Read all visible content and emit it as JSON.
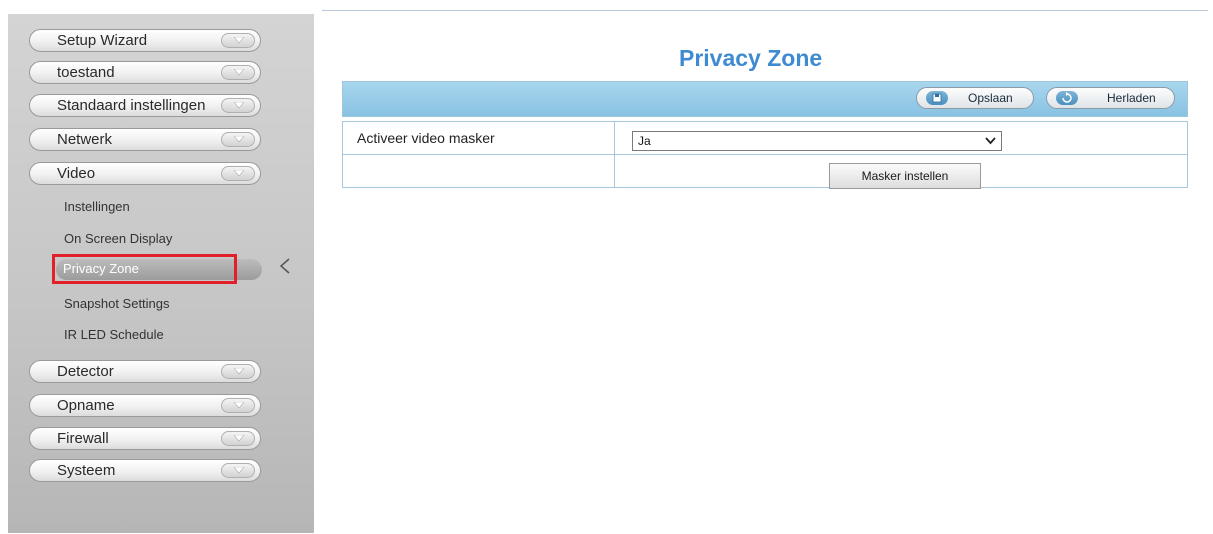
{
  "sidebar": {
    "top_items": [
      {
        "label": "Setup Wizard"
      },
      {
        "label": "toestand"
      },
      {
        "label": "Standaard instellingen"
      },
      {
        "label": "Netwerk"
      },
      {
        "label": "Video"
      }
    ],
    "video_sub_items": [
      {
        "label": "Instellingen"
      },
      {
        "label": "On Screen Display"
      },
      {
        "label": "Privacy Zone"
      },
      {
        "label": "Snapshot Settings"
      },
      {
        "label": "IR LED Schedule"
      }
    ],
    "active_sub_item": "Privacy Zone",
    "bottom_items": [
      {
        "label": "Detector"
      },
      {
        "label": "Opname"
      },
      {
        "label": "Firewall"
      },
      {
        "label": "Systeem"
      }
    ]
  },
  "main": {
    "title": "Privacy Zone",
    "toolbar": {
      "save_label": "Opslaan",
      "reload_label": "Herladen"
    },
    "form": {
      "mask_label": "Activeer video masker",
      "mask_select_value": "Ja",
      "mask_button_label": "Masker instellen"
    }
  },
  "colors": {
    "title": "#3f8bd2",
    "toolbar": "#98cce8",
    "highlight": "#e2202a"
  },
  "icons": [
    "chevron-down-icon",
    "save-icon",
    "reload-icon",
    "pointer-arrow-icon",
    "dropdown-arrow-icon"
  ]
}
